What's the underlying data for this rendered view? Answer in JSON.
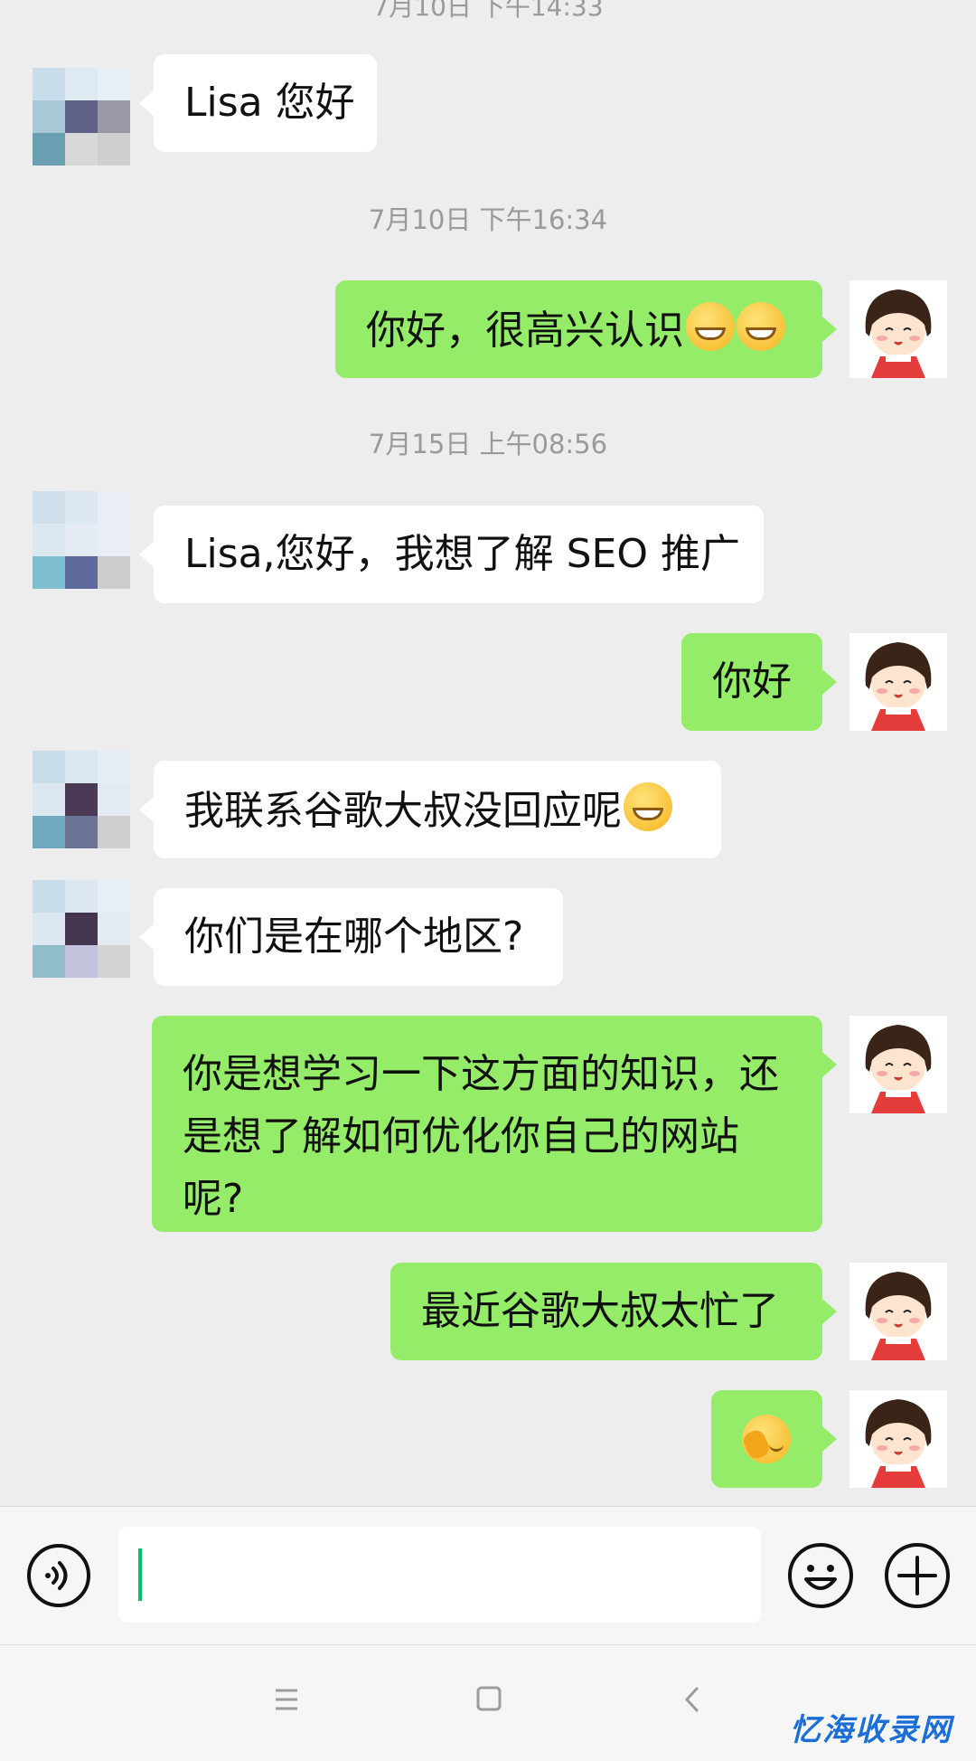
{
  "chat": {
    "top_time_partial": "7月10日 下午14:33",
    "messages": [
      {
        "kind": "in",
        "text": "Lisa 您好"
      },
      {
        "kind": "time",
        "text": "7月10日 下午16:34"
      },
      {
        "kind": "out",
        "text": "你好，很高兴认识"
      },
      {
        "kind": "time",
        "text": "7月15日 上午08:56"
      },
      {
        "kind": "in",
        "text": "Lisa,您好，我想了解 SEO 推广"
      },
      {
        "kind": "out",
        "text": "你好"
      },
      {
        "kind": "in",
        "text": "我联系谷歌大叔没回应呢"
      },
      {
        "kind": "in",
        "text": "你们是在哪个地区?"
      },
      {
        "kind": "out",
        "text": "你是想学习一下这方面的知识，还是想了解如何优化你自己的网站呢?"
      },
      {
        "kind": "out",
        "text": "最近谷歌大叔太忙了"
      },
      {
        "kind": "out",
        "text": ""
      }
    ]
  },
  "input": {
    "placeholder": "",
    "value": ""
  },
  "icons": {
    "voice": "voice-icon",
    "emoji": "emoji-icon",
    "plus": "plus-icon",
    "nav_menu": "menu-icon",
    "nav_home": "home-icon",
    "nav_back": "back-icon"
  },
  "colors": {
    "background": "#ededed",
    "out_bubble": "#95ec69",
    "in_bubble": "#ffffff",
    "cursor": "#07c160"
  },
  "watermark": "忆海收录网"
}
